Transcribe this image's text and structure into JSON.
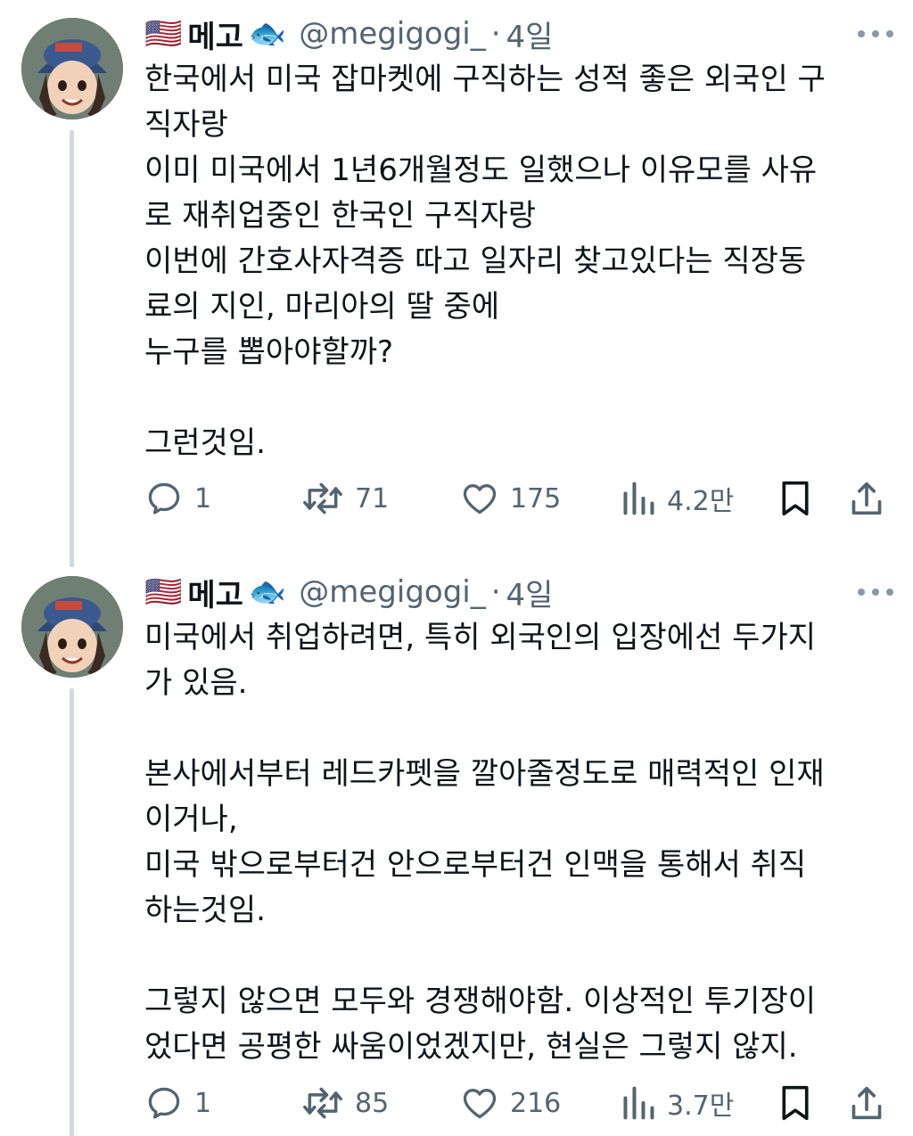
{
  "colors": {
    "text": "#0f1419",
    "secondary": "#536471",
    "thread_line": "#cfd9de"
  },
  "tweets": [
    {
      "flag": "🇺🇸",
      "display_name": "메고",
      "fish": "🐟",
      "handle": "@megigogi_",
      "separator": "·",
      "time": "4일",
      "lines": [
        "한국에서 미국 잡마켓에 구직하는 성적 좋은 외국인 구",
        "직자랑",
        "이미 미국에서 1년6개월정도 일했으나 이유모를 사유",
        "로 재취업중인 한국인 구직자랑",
        "이번에 간호사자격증 따고 일자리 찾고있다는 직장동",
        "료의 지인, 마리아의 딸 중에",
        "누구를 뽑아야할까?",
        "",
        "그런것임."
      ],
      "replies": "1",
      "retweets": "71",
      "likes": "175",
      "views": "4.2만"
    },
    {
      "flag": "🇺🇸",
      "display_name": "메고",
      "fish": "🐟",
      "handle": "@megigogi_",
      "separator": "·",
      "time": "4일",
      "lines": [
        "미국에서 취업하려면, 특히 외국인의 입장에선 두가지",
        "가 있음.",
        "",
        "본사에서부터 레드카펫을 깔아줄정도로 매력적인 인재",
        "이거나,",
        "미국 밖으로부터건 안으로부터건 인맥을 통해서 취직",
        "하는것임.",
        "",
        "그렇지 않으면 모두와 경쟁해야함. 이상적인 투기장이",
        "었다면 공평한 싸움이었겠지만, 현실은 그렇지 않지."
      ],
      "replies": "1",
      "retweets": "85",
      "likes": "216",
      "views": "3.7만"
    }
  ]
}
